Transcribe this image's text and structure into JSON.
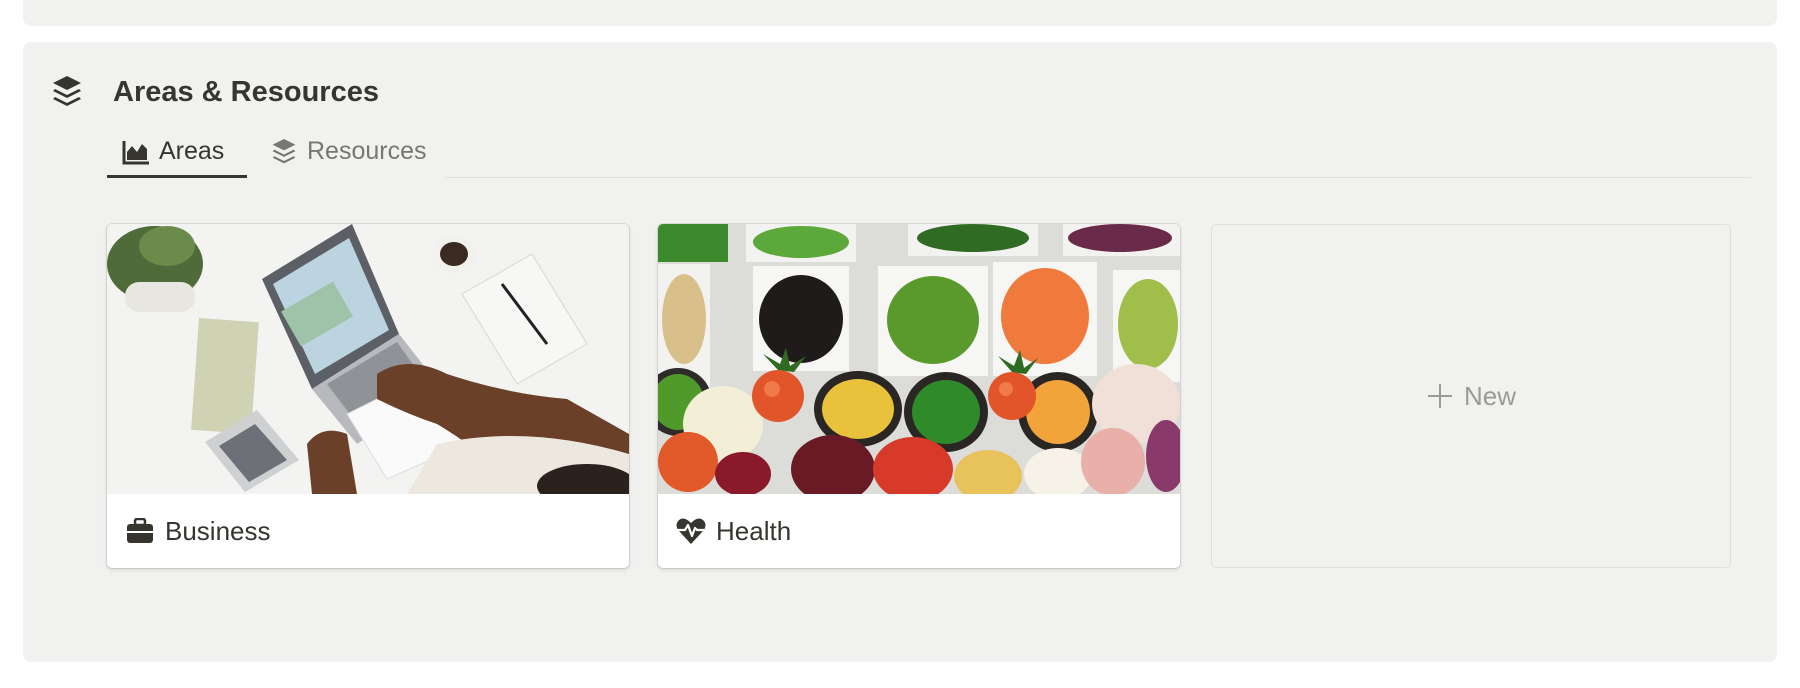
{
  "section": {
    "icon": "layers-icon",
    "title": "Areas & Resources"
  },
  "tabs": [
    {
      "label": "Areas",
      "icon": "area-chart-icon",
      "active": true
    },
    {
      "label": "Resources",
      "icon": "layers-icon",
      "active": false
    }
  ],
  "cards": [
    {
      "title": "Business",
      "icon": "briefcase-icon",
      "cover": "laptop-desk-photo"
    },
    {
      "title": "Health",
      "icon": "heartbeat-icon",
      "cover": "salad-bar-photo"
    }
  ],
  "new_card": {
    "label": "New",
    "icon": "plus-icon"
  },
  "colors": {
    "panel_bg": "#f1f1ef",
    "text": "#37352f",
    "muted_text": "#787774",
    "placeholder_text": "#9b9a97"
  }
}
